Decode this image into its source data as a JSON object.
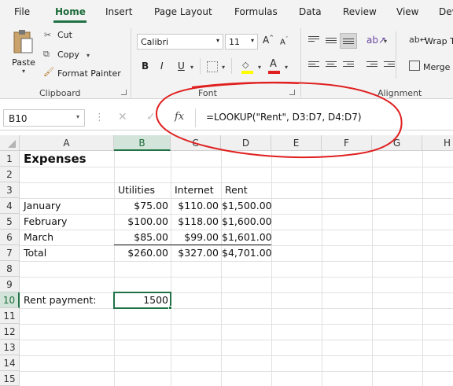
{
  "menu": {
    "file": "File",
    "home": "Home",
    "insert": "Insert",
    "page_layout": "Page Layout",
    "formulas": "Formulas",
    "data": "Data",
    "review": "Review",
    "view": "View",
    "developer": "Dev"
  },
  "ribbon": {
    "clipboard": {
      "paste": "Paste",
      "cut": "Cut",
      "copy": "Copy",
      "format_painter": "Format Painter",
      "label": "Clipboard"
    },
    "font": {
      "name": "Calibri",
      "size": "11",
      "grow": "A",
      "shrink": "A",
      "bold": "B",
      "italic": "I",
      "underline": "U",
      "font_color": "A",
      "label": "Font"
    },
    "alignment": {
      "wrap": "Wrap T",
      "merge": "Merge",
      "label": "Alignment"
    }
  },
  "formula_bar": {
    "name_box": "B10",
    "fx": "fx",
    "formula": "=LOOKUP(\"Rent\", D3:D7, D4:D7)"
  },
  "columns": [
    "A",
    "B",
    "C",
    "D",
    "E",
    "F",
    "G",
    "H"
  ],
  "rows": [
    "1",
    "2",
    "3",
    "4",
    "5",
    "6",
    "7",
    "8",
    "9",
    "10",
    "11",
    "12",
    "13",
    "14",
    "15"
  ],
  "cells": {
    "a1": "Expenses",
    "b3": "Utilities",
    "c3": "Internet",
    "d3": "Rent",
    "a4": "January",
    "b4": "$75.00",
    "c4": "$110.00",
    "d4": "$1,500.00",
    "a5": "February",
    "b5": "$100.00",
    "c5": "$118.00",
    "d5": "$1,600.00",
    "a6": "March",
    "b6": "$85.00",
    "c6": "$99.00",
    "d6": "$1,601.00",
    "a7": "Total",
    "b7": "$260.00",
    "c7": "$327.00",
    "d7": "$4,701.00",
    "a10": "Rent payment:",
    "b10": "1500"
  },
  "colors": {
    "accent": "#217346",
    "annotation": "#e02020"
  }
}
